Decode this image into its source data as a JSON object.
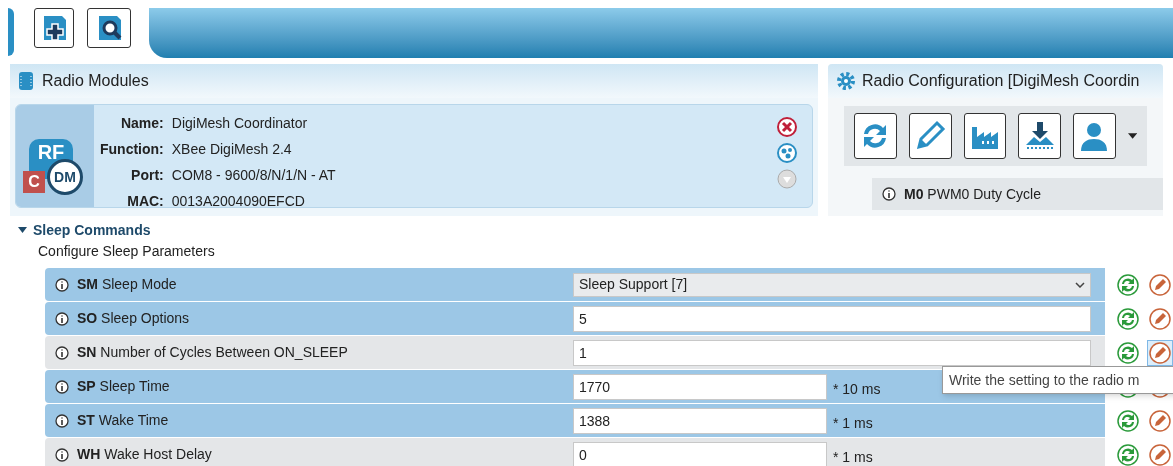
{
  "modules_panel": {
    "title": "Radio Modules",
    "module": {
      "badge_letter": "C",
      "badge_text": "DM",
      "logo_text": "RF",
      "fields": [
        {
          "label": "Name:",
          "value": "DigiMesh Coordinator"
        },
        {
          "label": "Function:",
          "value": "XBee DigiMesh 2.4"
        },
        {
          "label": "Port:",
          "value": "COM8 - 9600/8/N/1/N - AT"
        },
        {
          "label": "MAC:",
          "value": "0013A2004090EFCD"
        }
      ]
    }
  },
  "config_panel": {
    "title": "Radio Configuration [DigiMesh Coordin",
    "first_setting": {
      "code": "M0",
      "name": "PWM0 Duty Cycle"
    }
  },
  "section": {
    "title": "Sleep Commands",
    "expanded": true,
    "description": "Configure Sleep Parameters",
    "settings": [
      {
        "code": "SM",
        "name": "Sleep Mode",
        "kind": "dropdown",
        "value": "Sleep Support [7]",
        "modified": true,
        "write_hovered": false
      },
      {
        "code": "SO",
        "name": "Sleep Options",
        "kind": "text",
        "value": "5",
        "modified": true,
        "write_hovered": false
      },
      {
        "code": "SN",
        "name": "Number of Cycles Between ON_SLEEP",
        "kind": "text",
        "value": "1",
        "modified": false,
        "write_hovered": true
      },
      {
        "code": "SP",
        "name": "Sleep Time",
        "kind": "unit",
        "value": "1770",
        "unit": "* 10 ms",
        "modified": true,
        "write_hovered": false
      },
      {
        "code": "ST",
        "name": "Wake Time",
        "kind": "unit",
        "value": "1388",
        "unit": "* 1 ms",
        "modified": true,
        "write_hovered": false
      },
      {
        "code": "WH",
        "name": "Wake Host Delay",
        "kind": "unit",
        "value": "0",
        "unit": "* 1 ms",
        "modified": false,
        "write_hovered": false
      }
    ]
  },
  "tooltip": "Write the setting to the radio m"
}
